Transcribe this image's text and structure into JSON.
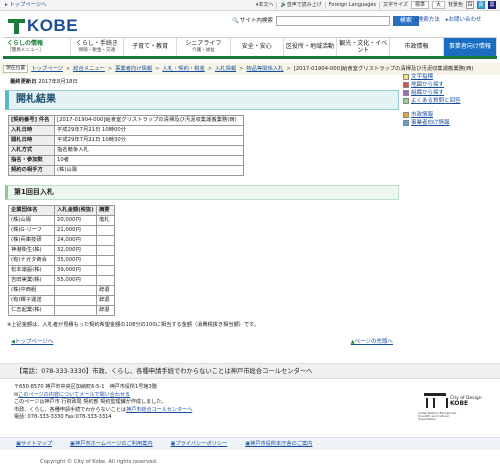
{
  "topbar": {
    "top_link": "トップページへ",
    "text_size": "本文へ",
    "read_aloud": "音声で読み上げ",
    "foreign": "Foreign Languages",
    "font_size_label": "文字サイズ",
    "font_std": "標準",
    "font_large": "大",
    "bg_label": "背景色",
    "bg_white": "白",
    "bg_blue": "青",
    "bg_black": "黒"
  },
  "header": {
    "logo_text": "KOBE",
    "search_label": "サイト内検索",
    "search_button": "検索",
    "link_howto": "検索方法",
    "link_contact": "お問い合わせ"
  },
  "gnav": [
    {
      "title": "くらしの情報",
      "sub": "［簡易メニュー］"
    },
    {
      "title": "くらし・手続き",
      "sub": "保険・税金・交通"
    },
    {
      "title": "子育て・教育",
      "sub": ""
    },
    {
      "title": "シニアライフ",
      "sub": "介護・福祉"
    },
    {
      "title": "安全・安心",
      "sub": ""
    },
    {
      "title": "区役所・地域活動",
      "sub": ""
    },
    {
      "title": "観光・文化・イベント",
      "sub": ""
    },
    {
      "title": "市政情報",
      "sub": ""
    },
    {
      "title": "事業者向け情報",
      "sub": ""
    }
  ],
  "breadcrumb": {
    "here": "現在位置",
    "items": [
      "トップページ",
      "総合メニュー",
      "事業者向け情報",
      "入札・契約・税金",
      "入札情報",
      "物品等関係入札"
    ],
    "current": "[2017-01904-000]給食室グリストラップの清掃及び汚泥収集運搬業務(西)"
  },
  "updated": {
    "label": "最終更新日",
    "value": "2017年8月18日"
  },
  "main": {
    "title": "開札結果",
    "info_rows": [
      {
        "k": "[契約番号] 件名",
        "v": "[2017-01904-000]給食室グリストラップの清掃及び汚泥収集運搬業務(西)"
      },
      {
        "k": "入札日時",
        "v": "平成29年7月21日 10時00分"
      },
      {
        "k": "開札日時",
        "v": "平成29年7月21日 10時30分"
      },
      {
        "k": "入札方式",
        "v": "指名競争入札"
      },
      {
        "k": "指名・参加数",
        "v": "10者"
      },
      {
        "k": "契約の相手方",
        "v": "(株)山陽"
      }
    ],
    "round_title": "第1回目入札",
    "bid_headers": [
      "企業団体名",
      "入札金額(税抜)",
      "摘要"
    ],
    "bids": [
      [
        "(株)山陽",
        "20,000円",
        "落札"
      ],
      [
        "(株)G-リーフ",
        "21,000円",
        ""
      ],
      [
        "(株)兵庫技研",
        "24,000円",
        ""
      ],
      [
        "神港衛生(株)",
        "32,000円",
        ""
      ],
      [
        "(有)ナガタ商会",
        "35,000円",
        ""
      ],
      [
        "松本運設(株)",
        "39,000円",
        ""
      ],
      [
        "吉田実業(株)",
        "55,000円",
        ""
      ],
      [
        "(株)中西組",
        "",
        "辞退"
      ],
      [
        "(有)輝子運送",
        "",
        "辞退"
      ],
      [
        "仁志起業(株)",
        "",
        "辞退"
      ]
    ],
    "note": "※上記金額は、入札者が見積もった契約希望金額の108分の100に相当する金額（消費税抜き相当額）です。",
    "to_top": "トップページへ",
    "to_page_top": "ページの先頭へ"
  },
  "sidebar": {
    "links": [
      {
        "label": "文字指標",
        "icon": "yellow-square"
      },
      {
        "label": "地図から探す",
        "icon": "red-square"
      },
      {
        "label": "組織から探す",
        "icon": "purple-square"
      },
      {
        "label": "よくある質問と回答",
        "icon": "green-square"
      }
    ],
    "links2": [
      {
        "label": "市政情報",
        "icon": "orange-square"
      },
      {
        "label": "事業者向け情報",
        "icon": "blue-square"
      }
    ]
  },
  "footer": {
    "call": "【電話：078-333-3330】市政、くらし、各種申請手続でわからないことは神戸市総合コールセンターへ",
    "addr1": "〒650-8570 神戸市中央区加納町6-5-1　神戸市役所1号館3階",
    "addr2": "このページの内容についてメールで問い合わせる",
    "addr3": "このページは神戸市 行財政局 契約部 契約監理課が作成しました。",
    "addr4_prefix": "市政、くらし、各種申請手続でわからないことは",
    "addr4_link": "神戸市総合コールセンターへ",
    "addr5": "電話: 078-333-3330 Fax:078-333-3314",
    "unesco_city": "City of Design",
    "unesco_name": "KOBE",
    "unesco_caption": "United Nations Educational, Scientific and Cultural Organization",
    "links": [
      "サイトマップ",
      "神戸市ホームページのご利用案内",
      "プライバシーポリシー",
      "神戸市役所本庁舎のご案内"
    ],
    "copyright": "Copyright © City of Kobe. All rights reserved."
  }
}
